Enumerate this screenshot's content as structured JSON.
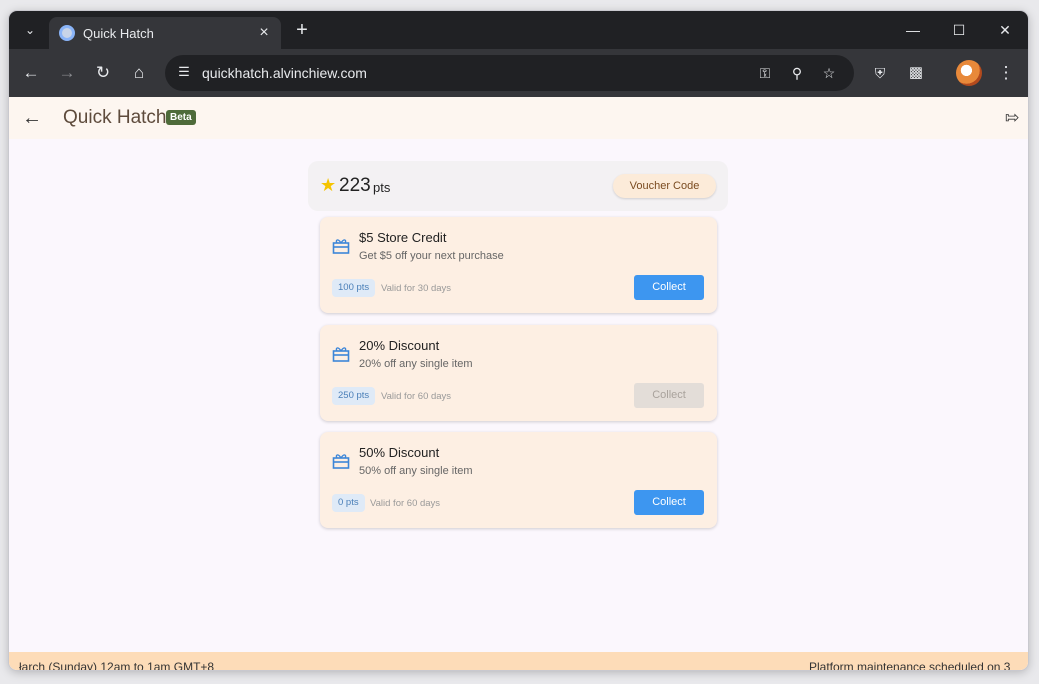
{
  "browser": {
    "tab_title": "Quick Hatch",
    "url": "quickhatch.alvinchiew.com",
    "new_tab": "+",
    "tab_close": "×"
  },
  "app": {
    "title": "Quick Hatch",
    "badge": "Beta"
  },
  "points": {
    "value": "223",
    "unit": "pts",
    "voucher_button": "Voucher Code"
  },
  "rewards": [
    {
      "title": "$5 Store Credit",
      "description": "Get $5 off your next purchase",
      "cost": "100 pts",
      "validity": "Valid for 30 days",
      "button": "Collect",
      "enabled": true
    },
    {
      "title": "20% Discount",
      "description": "20% off any single item",
      "cost": "250 pts",
      "validity": "Valid for 60 days",
      "button": "Collect",
      "enabled": false
    },
    {
      "title": "50% Discount",
      "description": "50% off any single item",
      "cost": "0 pts",
      "validity": "Valid for 60 days",
      "button": "Collect",
      "enabled": true
    }
  ],
  "banner": {
    "left_text": "łarch (Sunday) 12am to 1am GMT+8",
    "right_text": "Platform maintenance scheduled on 3"
  },
  "colors": {
    "accent": "#3d96f0",
    "badge": "#4e6b3a",
    "banner": "#fddcb8",
    "card": "#fdefe3"
  }
}
